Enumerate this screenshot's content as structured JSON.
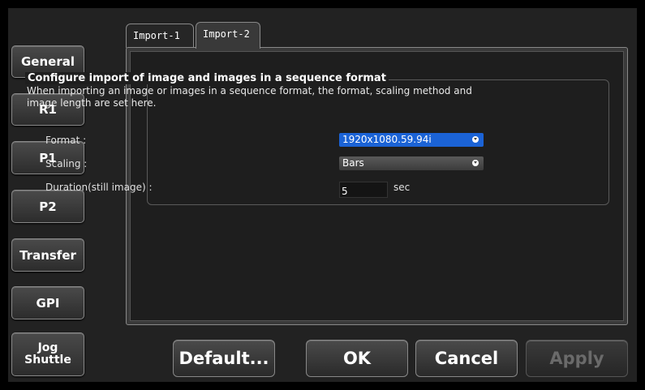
{
  "sidebar": {
    "items": [
      {
        "label": "General"
      },
      {
        "label": "R1"
      },
      {
        "label": "P1"
      },
      {
        "label": "P2"
      },
      {
        "label": "Transfer"
      },
      {
        "label": "GPI"
      },
      {
        "label": "Jog\nShuttle"
      }
    ]
  },
  "tabs": [
    {
      "label": "Import-1",
      "active": false
    },
    {
      "label": "Import-2",
      "active": true
    }
  ],
  "group": {
    "title": "Configure import of image and images in a sequence format",
    "description": "When importing an image or images in a sequence format, the format, scaling method and image length are set here."
  },
  "fields": {
    "format": {
      "label": "Format :",
      "value": "1920x1080.59.94i"
    },
    "scaling": {
      "label": "Scaling :",
      "value": "Bars"
    },
    "duration": {
      "label": "Duration(still image) :",
      "value": "5",
      "unit": "sec"
    }
  },
  "buttons": {
    "default": "Default...",
    "ok": "OK",
    "cancel": "Cancel",
    "apply": "Apply"
  },
  "colors": {
    "selected_dropdown": "#1b63d6",
    "background": "#000000",
    "panel": "#393939"
  }
}
